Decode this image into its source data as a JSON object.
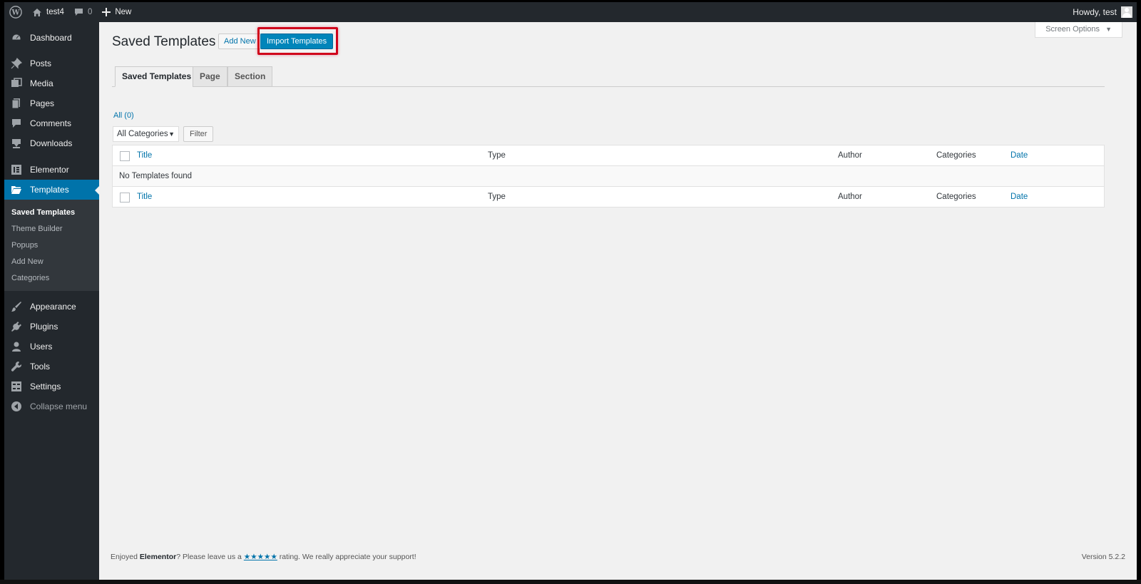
{
  "adminbar": {
    "site_name": "test4",
    "comments_count": "0",
    "new_label": "New",
    "howdy": "Howdy, test"
  },
  "sidebar": {
    "items": [
      {
        "label": "Dashboard",
        "icon": "dashboard-icon"
      },
      {
        "label": "Posts",
        "icon": "pin-icon"
      },
      {
        "label": "Media",
        "icon": "media-icon"
      },
      {
        "label": "Pages",
        "icon": "pages-icon"
      },
      {
        "label": "Comments",
        "icon": "comment-icon"
      },
      {
        "label": "Downloads",
        "icon": "download-icon"
      },
      {
        "label": "Elementor",
        "icon": "elementor-icon"
      },
      {
        "label": "Templates",
        "icon": "folder-icon",
        "active": true
      },
      {
        "label": "Appearance",
        "icon": "brush-icon"
      },
      {
        "label": "Plugins",
        "icon": "plugin-icon"
      },
      {
        "label": "Users",
        "icon": "user-icon"
      },
      {
        "label": "Tools",
        "icon": "wrench-icon"
      },
      {
        "label": "Settings",
        "icon": "settings-icon"
      }
    ],
    "submenu": [
      "Saved Templates",
      "Theme Builder",
      "Popups",
      "Add New",
      "Categories"
    ],
    "collapse_label": "Collapse menu"
  },
  "header": {
    "title": "Saved Templates",
    "add_new": "Add New",
    "import": "Import Templates",
    "screen_options": "Screen Options"
  },
  "tabs": [
    "Saved Templates",
    "Page",
    "Section"
  ],
  "filter": {
    "count": "All (0)",
    "category": "All Categories",
    "button": "Filter"
  },
  "table": {
    "columns": [
      "Title",
      "Type",
      "Author",
      "Categories",
      "Date"
    ],
    "empty": "No Templates found"
  },
  "footer": {
    "pre": "Enjoyed ",
    "brand": "Elementor",
    "mid": "? Please leave us a ",
    "stars": "★★★★★",
    "post": " rating. We really appreciate your support!",
    "version": "Version 5.2.2"
  },
  "colors": {
    "accent": "#0073aa",
    "button_primary": "#0085ba",
    "highlight": "#d0021b",
    "sidebar": "#23282d"
  }
}
